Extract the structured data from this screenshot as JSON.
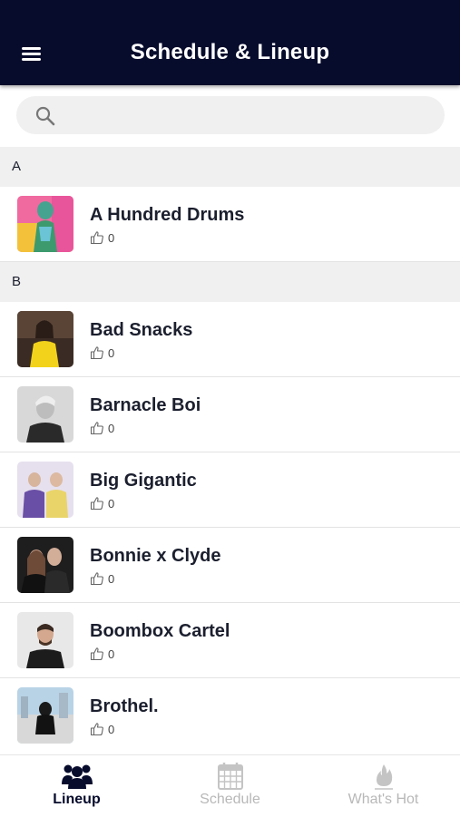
{
  "header": {
    "title": "Schedule & Lineup",
    "menu_icon": "hamburger-menu-icon"
  },
  "search": {
    "placeholder": "",
    "value": "",
    "icon": "search-icon"
  },
  "sections": [
    {
      "letter": "A",
      "artists": [
        {
          "name": "A Hundred Drums",
          "likes": "0"
        }
      ]
    },
    {
      "letter": "B",
      "artists": [
        {
          "name": "Bad Snacks",
          "likes": "0"
        },
        {
          "name": "Barnacle Boi",
          "likes": "0"
        },
        {
          "name": "Big Gigantic",
          "likes": "0"
        },
        {
          "name": "Bonnie x Clyde",
          "likes": "0"
        },
        {
          "name": "Boombox Cartel",
          "likes": "0"
        },
        {
          "name": "Brothel.",
          "likes": "0"
        }
      ]
    }
  ],
  "tabs": [
    {
      "label": "Lineup",
      "icon": "people-icon",
      "active": true
    },
    {
      "label": "Schedule",
      "icon": "calendar-icon",
      "active": false
    },
    {
      "label": "What's Hot",
      "icon": "flame-icon",
      "active": false
    }
  ],
  "colors": {
    "header_bg": "#070b2c",
    "section_bg": "#f0f0f0",
    "inactive_tab": "#b8b8b8",
    "text": "#1b1f2e"
  }
}
